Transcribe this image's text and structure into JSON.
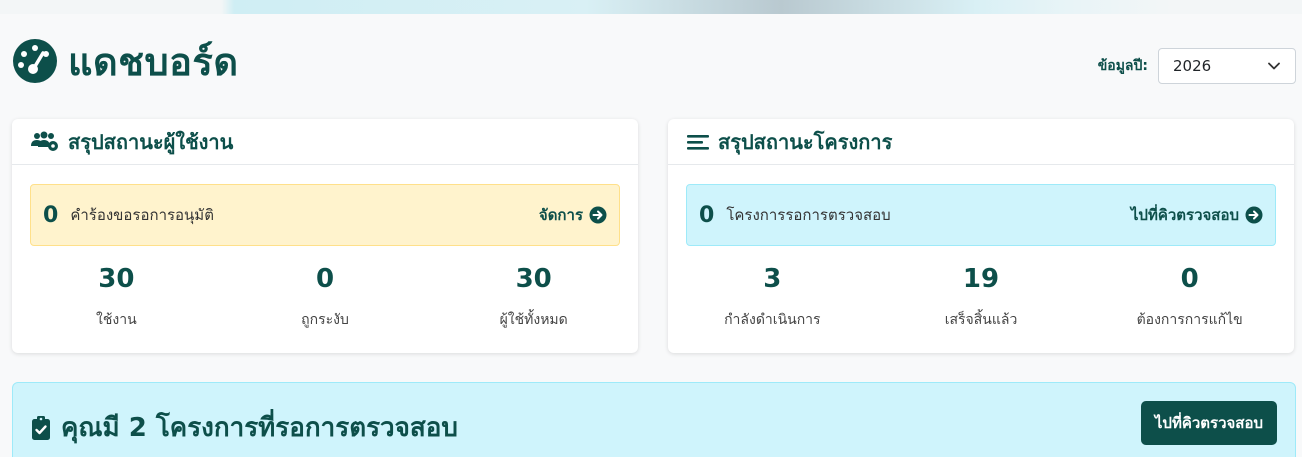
{
  "header": {
    "title": "แดชบอร์ด",
    "year_label": "ข้อมูลปี:",
    "year_value": "2026"
  },
  "user_summary": {
    "title": "สรุปสถานะผู้ใช้งาน",
    "alert": {
      "count": "0",
      "text": "คำร้องขอรอการอนุมัติ",
      "link": "จัดการ"
    },
    "stats": [
      {
        "value": "30",
        "label": "ใช้งาน"
      },
      {
        "value": "0",
        "label": "ถูกระงับ"
      },
      {
        "value": "30",
        "label": "ผู้ใช้ทั้งหมด"
      }
    ]
  },
  "project_summary": {
    "title": "สรุปสถานะโครงการ",
    "alert": {
      "count": "0",
      "text": "โครงการรอการตรวจสอบ",
      "link": "ไปที่คิวตรวจสอบ"
    },
    "stats": [
      {
        "value": "3",
        "label": "กำลังดำเนินการ"
      },
      {
        "value": "19",
        "label": "เสร็จสิ้นแล้ว"
      },
      {
        "value": "0",
        "label": "ต้องการการแก้ไข"
      }
    ]
  },
  "banner": {
    "text": "คุณมี 2 โครงการที่รอการตรวจสอบ",
    "button": "ไปที่คิวตรวจสอบ"
  },
  "colors": {
    "primary": "#0d4f4a",
    "warning_bg": "#fff3cd",
    "info_bg": "#cff4fc"
  },
  "icons": {
    "title": "dashboard-gauge-icon",
    "users": "users-cog-icon",
    "projects": "list-icon",
    "arrow": "arrow-circle-right-icon",
    "dropdown": "chevron-down-icon",
    "clipboard": "clipboard-check-icon"
  }
}
